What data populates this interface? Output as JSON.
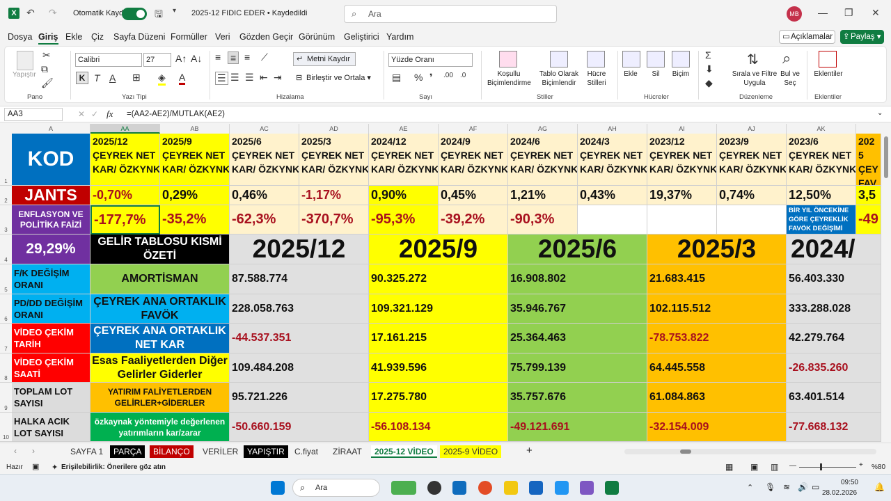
{
  "titlebar": {
    "autosave": "Otomatik Kaydet",
    "doc": "2025-12 FIDIC EDER • Kaydedildi",
    "search": "Ara",
    "avatar": "MB"
  },
  "menu": {
    "items": [
      "Dosya",
      "Giriş",
      "Ekle",
      "Çiz",
      "Sayfa Düzeni",
      "Formüller",
      "Veri",
      "Gözden Geçir",
      "Görünüm",
      "Geliştirici",
      "Yardım"
    ],
    "comments": "Açıklamalar",
    "share": "Paylaş"
  },
  "ribbon": {
    "paste": "Yapıştır",
    "font": "Calibri",
    "size": "27",
    "bold": "K",
    "italic": "T",
    "underline": "A",
    "wrap": "Metni Kaydır",
    "merge": "Birleştir ve Ortala",
    "numfmt": "Yüzde Oranı",
    "cond": "Koşullu\nBiçimlendirme",
    "table": "Tablo Olarak\nBiçimlendir",
    "styles": "Hücre\nStilleri",
    "insert": "Ekle",
    "delete": "Sil",
    "format": "Biçim",
    "sort": "Sırala ve Filtre\nUygula",
    "find": "Bul ve\nSeç",
    "addins": "Eklentiler",
    "groups": [
      "Pano",
      "Yazı Tipi",
      "Hizalama",
      "Sayı",
      "Stiller",
      "Hücreler",
      "Düzenleme",
      "Eklentiler"
    ]
  },
  "formula": {
    "namebox": "AA3",
    "fx": "fx",
    "text": "=(AA2-AE2)/MUTLAK(AE2)"
  },
  "cols": [
    "A",
    "AA",
    "AB",
    "AC",
    "AD",
    "AE",
    "AF",
    "AG",
    "AH",
    "AI",
    "AJ",
    "AK"
  ],
  "rows": [
    "1",
    "2",
    "3",
    "4",
    "5",
    "6",
    "7",
    "8",
    "9",
    "10"
  ],
  "sheet": {
    "a1": "KOD",
    "a2": "JANTS",
    "a3": "ENFLASYON VE POLİTİKA FAİZİ",
    "a4": "29,29%",
    "a5": "F/K DEĞİŞİM ORANI",
    "a6": "PD/DD DEĞİŞİM ORANI",
    "a7": "VİDEO ÇEKİM TARİH",
    "a8": "VİDEO ÇEKİM SAATİ",
    "a9": "TOPLAM LOT SAYISI",
    "a10": "HALKA ACIK LOT SAYISI",
    "periods": [
      "2025/12",
      "2025/9",
      "2025/6",
      "2025/3",
      "2024/12",
      "2024/9",
      "2024/6",
      "2024/3",
      "2023/12",
      "2023/9",
      "2023/6",
      "2025"
    ],
    "hdr_l1": "ÇEYREK NET",
    "hdr_l2": "KAR/ ÖZKYNK",
    "hdr_partial": "ÇEY FAVÖ ÖZKY",
    "row2": [
      "-0,70%",
      "0,29%",
      "0,46%",
      "-1,17%",
      "0,90%",
      "0,45%",
      "1,21%",
      "0,43%",
      "19,37%",
      "0,74%",
      "12,50%",
      "3,5"
    ],
    "row3": [
      "-177,7%",
      "-35,2%",
      "-62,3%",
      "-370,7%",
      "-95,3%",
      "-39,2%",
      "-90,3%",
      "",
      "",
      "",
      "BİR YIL ÖNCEKİNE GÖRE ÇEYREKLİK FAVÖK DEĞİŞİMİ",
      "-49"
    ],
    "b4": "GELİR TABLOSU KISMİ ÖZETİ",
    "years": [
      "2025/12",
      "2025/9",
      "2025/6",
      "2025/3",
      "2024/"
    ],
    "labels": [
      "AMORTİSMAN",
      "ÇEYREK ANA ORTAKLIK FAVÖK",
      "ÇEYREK ANA ORTAKLIK NET KAR",
      "Esas Faaliyetlerden Diğer Gelirler Giderler",
      "YATIRIM FALİYETLERDEN GELİRLER+GİDERLER",
      "özkaynak yöntemiyle değerlenen yatırımların kar/zarar"
    ],
    "values": [
      [
        "87.588.774",
        "90.325.272",
        "16.908.802",
        "21.683.415",
        "56.403.330"
      ],
      [
        "228.058.763",
        "109.321.129",
        "35.946.767",
        "102.115.512",
        "333.288.028"
      ],
      [
        "-44.537.351",
        "17.161.215",
        "25.364.463",
        "-78.753.822",
        "42.279.764"
      ],
      [
        "109.484.208",
        "41.939.596",
        "75.799.139",
        "64.445.558",
        "-26.835.260"
      ],
      [
        "95.721.226",
        "17.275.780",
        "35.757.676",
        "61.084.863",
        "63.401.514"
      ],
      [
        "-50.660.159",
        "-56.108.134",
        "-49.121.691",
        "-32.154.009",
        "-77.668.132"
      ]
    ]
  },
  "tabs": [
    "SAYFA 1",
    "PARÇA",
    "BİLANÇO",
    "VERİLER",
    "YAPIŞTIR",
    "C.fiyat",
    "ZİRAAT",
    "2025-12 VİDEO",
    "2025-9 VİDEO"
  ],
  "status": {
    "ready": "Hazır",
    "access": "Erişilebilirlik: Önerilere göz atın",
    "zoom": "%80"
  },
  "taskbar": {
    "search": "Ara",
    "time": "09:50",
    "date": "28.02.2026"
  },
  "colors": {
    "excel": "#107c41",
    "yellow": "#ffff00",
    "cream": "#fff2cc",
    "red": "#c00000",
    "purple": "#7030a0",
    "cyan": "#00b0f0",
    "green": "#92d050",
    "orange": "#ffc000",
    "blue": "#0070c0",
    "lime": "#00b050"
  }
}
